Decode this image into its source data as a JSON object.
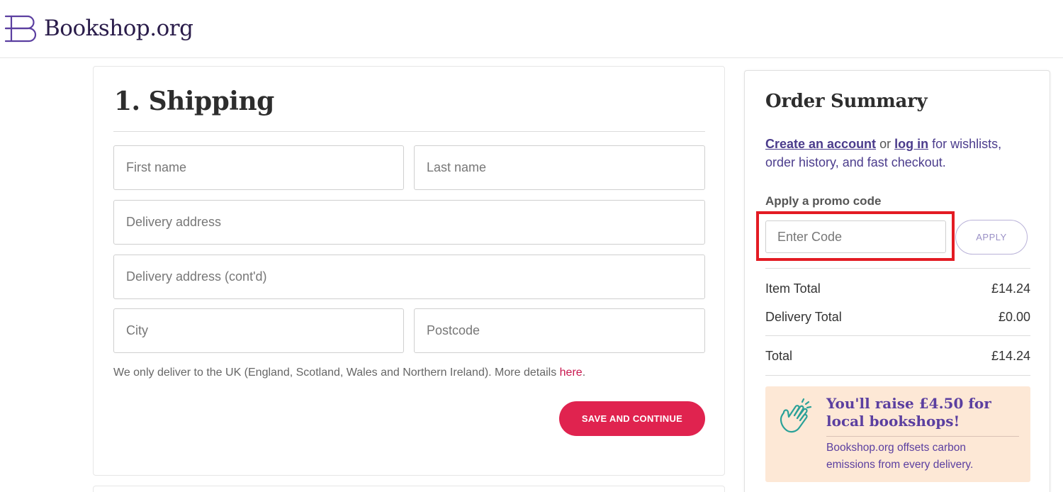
{
  "header": {
    "logo_text": "Bookshop.org"
  },
  "shipping": {
    "title": "1. Shipping",
    "fields": {
      "first_name": {
        "placeholder": "First name",
        "value": ""
      },
      "last_name": {
        "placeholder": "Last name",
        "value": ""
      },
      "address1": {
        "placeholder": "Delivery address",
        "value": ""
      },
      "address2": {
        "placeholder": "Delivery address (cont'd)",
        "value": ""
      },
      "city": {
        "placeholder": "City",
        "value": ""
      },
      "postcode": {
        "placeholder": "Postcode",
        "value": ""
      }
    },
    "note": "We only deliver to the UK (England, Scotland, Wales and Northern Ireland). More details ",
    "note_link": "here",
    "note_end": ".",
    "save_label": "SAVE AND CONTINUE"
  },
  "summary": {
    "title": "Order Summary",
    "create_account": "Create an account",
    "or": " or ",
    "log_in": "log in",
    "account_suffix": " for wishlists, order history, and fast checkout.",
    "promo_label": "Apply a promo code",
    "promo_placeholder": "Enter Code",
    "apply_label": "APPLY",
    "item_total_label": "Item Total",
    "item_total_value": "£14.24",
    "delivery_total_label": "Delivery Total",
    "delivery_total_value": "£0.00",
    "total_label": "Total",
    "total_value": "£14.24",
    "raise_title": "You'll raise £4.50 for local bookshops!",
    "raise_text": "Bookshop.org offsets carbon emissions from every delivery."
  },
  "colors": {
    "brand_purple": "#4b3c8c",
    "accent_red": "#e0234f",
    "highlight_red": "#e31b23",
    "raise_bg": "#fde8d6",
    "raise_icon": "#2aa198"
  },
  "icons": {
    "logo": "bookshop-b-logo-icon",
    "raise": "clapping-hands-icon"
  }
}
